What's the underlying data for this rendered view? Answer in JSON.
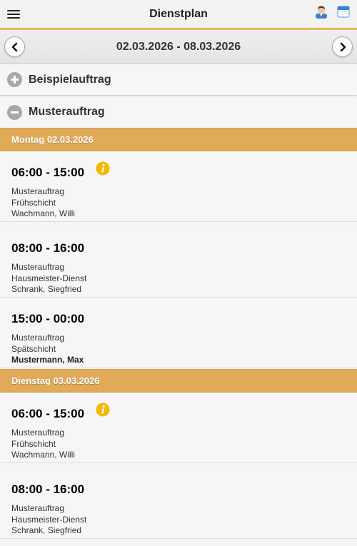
{
  "header": {
    "title": "Dienstplan",
    "menu_icon": "hamburger-menu-icon",
    "user_icon": "user-icon",
    "calendar_icon": "calendar-icon",
    "accent_color": "#e8b85f"
  },
  "week_nav": {
    "range": "02.03.2026 - 08.03.2026",
    "prev_icon": "chevron-left-icon",
    "next_icon": "chevron-right-icon"
  },
  "sections": [
    {
      "label": "Beispielauftrag",
      "state": "collapsed",
      "icon": "plus-icon"
    },
    {
      "label": "Musterauftrag",
      "state": "expanded",
      "icon": "minus-icon"
    }
  ],
  "days": [
    {
      "label": "Montag 02.03.2026",
      "shifts": [
        {
          "time": "06:00 - 15:00",
          "info": true,
          "order": "Musterauftrag",
          "shift": "Frühschicht",
          "person": "Wachmann, Willi",
          "person_bold": false
        },
        {
          "time": "08:00 - 16:00",
          "info": false,
          "order": "Musterauftrag",
          "shift": "Hausmeister-Dienst",
          "person": "Schrank, Siegfried",
          "person_bold": false
        },
        {
          "time": "15:00 - 00:00",
          "info": false,
          "order": "Musterauftrag",
          "shift": "Spätschicht",
          "person": "Mustermann, Max",
          "person_bold": true
        }
      ]
    },
    {
      "label": "Dienstag 03.03.2026",
      "shifts": [
        {
          "time": "06:00 - 15:00",
          "info": true,
          "order": "Musterauftrag",
          "shift": "Frühschicht",
          "person": "Wachmann, Willi",
          "person_bold": false
        },
        {
          "time": "08:00 - 16:00",
          "info": false,
          "order": "Musterauftrag",
          "shift": "Hausmeister-Dienst",
          "person": "Schrank, Siegfried",
          "person_bold": false
        }
      ]
    }
  ],
  "colors": {
    "day_header": "#e0aa58",
    "info_icon": "#f5b800"
  }
}
